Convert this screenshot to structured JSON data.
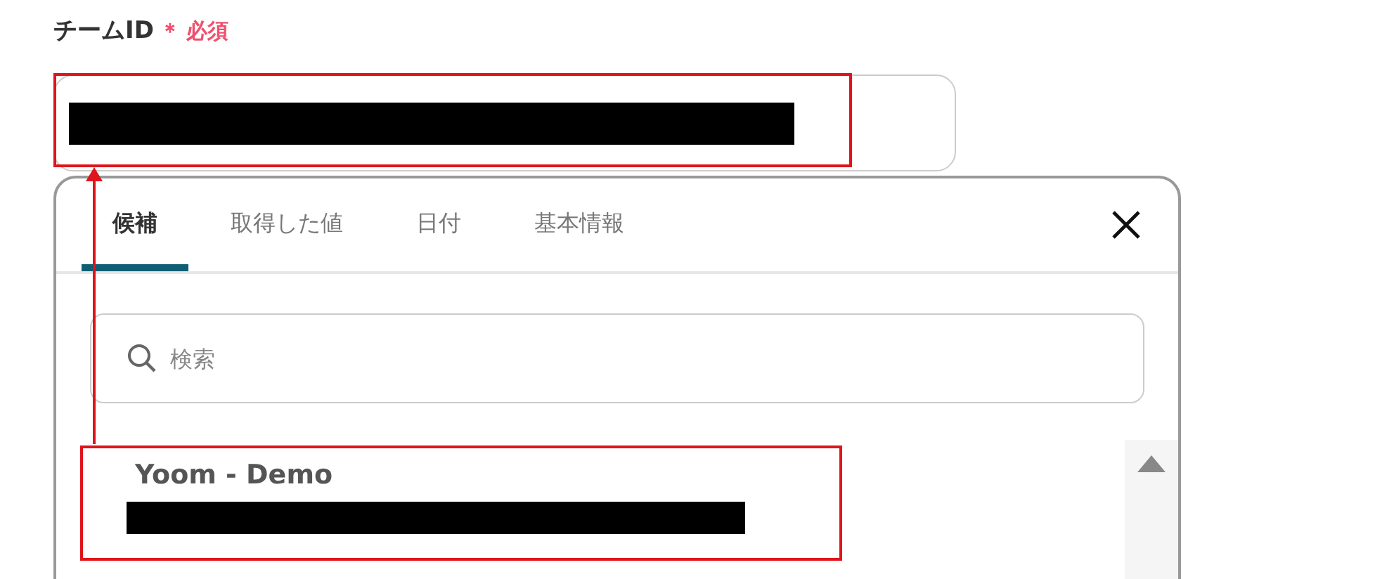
{
  "field": {
    "label": "チームID",
    "required_mark": "＊",
    "required_text": "必須"
  },
  "popup": {
    "tabs": [
      {
        "label": "候補",
        "selected": true
      },
      {
        "label": "取得した値",
        "selected": false
      },
      {
        "label": "日付",
        "selected": false
      },
      {
        "label": "基本情報",
        "selected": false
      }
    ],
    "search": {
      "placeholder": "検索"
    },
    "options": [
      {
        "title": "Yoom - Demo"
      }
    ]
  }
}
